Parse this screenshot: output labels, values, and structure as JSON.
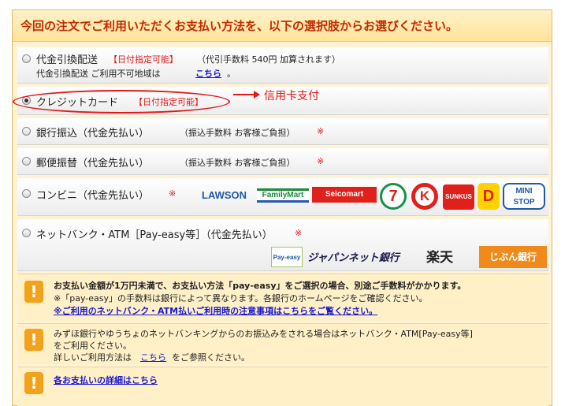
{
  "header": {
    "title": "今回の注文でご利用いただくお支払い方法を、以下の選択肢からお選びください。"
  },
  "options": {
    "cod": {
      "label": "代金引換配送",
      "badge": "【日付指定可能】",
      "fee": "（代引手数料 540円 加算されます）",
      "sub": "代金引換配送 ご利用不可地域は",
      "link": "こちら",
      "tail": "。"
    },
    "card": {
      "label": "クレジットカード",
      "badge": "【日付指定可能】",
      "annotation": "信用卡支付"
    },
    "bank": {
      "label": "銀行振込（代金先払い）",
      "fee": "（振込手数料 お客様ご負担）",
      "mark": "※"
    },
    "postal": {
      "label": "郵便振替（代金先払い）",
      "fee": "（振込手数料 お客様ご負担）",
      "mark": "※"
    },
    "convenience": {
      "label": "コンビニ（代金先払い）",
      "mark": "※"
    },
    "netbank": {
      "label": "ネットバンク・ATM［Pay-easy等］（代金先払い）",
      "mark": "※"
    }
  },
  "logos": {
    "lawson": "LAWSON",
    "familymart": "FamilyMart",
    "seicomart": "Seicomart",
    "seven": "7",
    "circlek": "K",
    "sunkus": "SUNKUS",
    "daily": "D",
    "ministop": "MINI STOP",
    "payeasy": "Pay-easy",
    "japannet": "ジャパンネット銀行",
    "rakuten": "楽天",
    "jibun": "じぶん銀行"
  },
  "notes": {
    "note1": {
      "line1": "お支払い金額が1万円未満で、お支払い方法「pay-easy」をご選択の場合、別途ご手数料がかかります。",
      "line2": "※「pay-easy」の手数料は銀行によって異なります。各銀行のホームページをご確認ください。",
      "link": "※ご利用のネットバンク・ATM払いご利用時の注意事項はこちらをご覧ください。"
    },
    "note2": {
      "line1": "みずほ銀行やゆうちょのネットバンキングからのお振込みをされる場合はネットバンク・ATM[Pay-easy等]",
      "line2": "をご利用ください。",
      "line3a": "詳しいご利用方法は",
      "line3link": "こちら",
      "line3b": "をご参照ください。"
    },
    "note3": {
      "link": "各お支払いの詳細はこちら"
    }
  }
}
